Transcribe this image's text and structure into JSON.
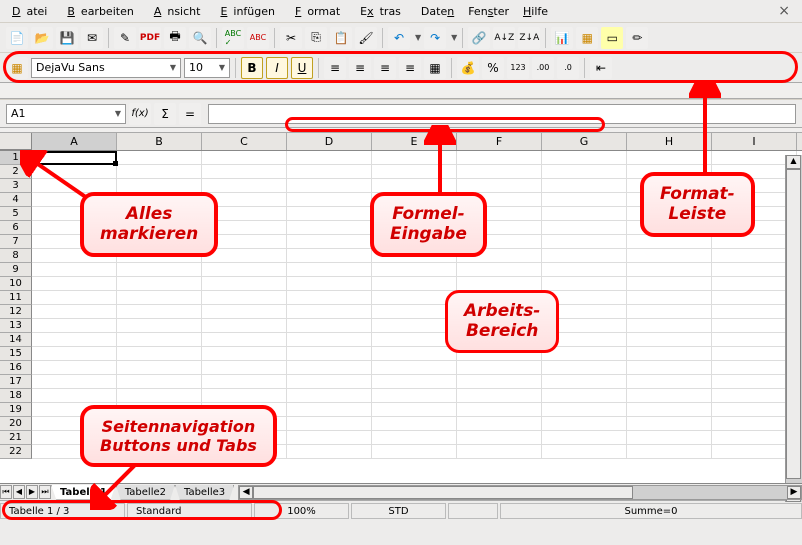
{
  "menu": {
    "items": [
      "Datei",
      "Bearbeiten",
      "Ansicht",
      "Einfügen",
      "Format",
      "Extras",
      "Daten",
      "Fenster",
      "Hilfe"
    ]
  },
  "toolbar1_icons": [
    "new",
    "open",
    "save",
    "mail",
    "edit",
    "pdf",
    "print",
    "preview",
    "spell",
    "autospell",
    "cut",
    "copy",
    "paste",
    "brush",
    "undo",
    "redo",
    "link",
    "sort-asc",
    "sort-desc",
    "chart",
    "nav",
    "hilite",
    "pen"
  ],
  "font": {
    "name": "DejaVu Sans",
    "size": "10"
  },
  "format_icons": [
    "style",
    "B",
    "I",
    "U",
    "align-l",
    "align-c",
    "align-r",
    "justify",
    "merge",
    "currency",
    "percent",
    "standard",
    "add-dec",
    "remove-dec",
    "indent"
  ],
  "cell_ref": "A1",
  "formula_btns": [
    "fx",
    "Σ",
    "="
  ],
  "columns": [
    "A",
    "B",
    "C",
    "D",
    "E",
    "F",
    "G",
    "H",
    "I"
  ],
  "rows": [
    1,
    2,
    3,
    4,
    5,
    6,
    7,
    8,
    9,
    10,
    11,
    12,
    13,
    14,
    15,
    16,
    17,
    18,
    19,
    20,
    21,
    22
  ],
  "tabs": {
    "nav": [
      "⏮",
      "◀",
      "▶",
      "⏭"
    ],
    "sheets": [
      "Tabelle1",
      "Tabelle2",
      "Tabelle3"
    ],
    "active": 0
  },
  "status": {
    "sheet": "Tabelle 1 / 3",
    "style": "Standard",
    "zoom": "100%",
    "mode": "STD",
    "sum": "Summe=0"
  },
  "annotations": {
    "select_all": "Alles\nmarkieren",
    "formula": "Formel-\nEingabe",
    "format_bar": "Format-\nLeiste",
    "workspace": "Arbeits-\nBereich",
    "tabs": "Seitennavigation\nButtons und Tabs"
  }
}
